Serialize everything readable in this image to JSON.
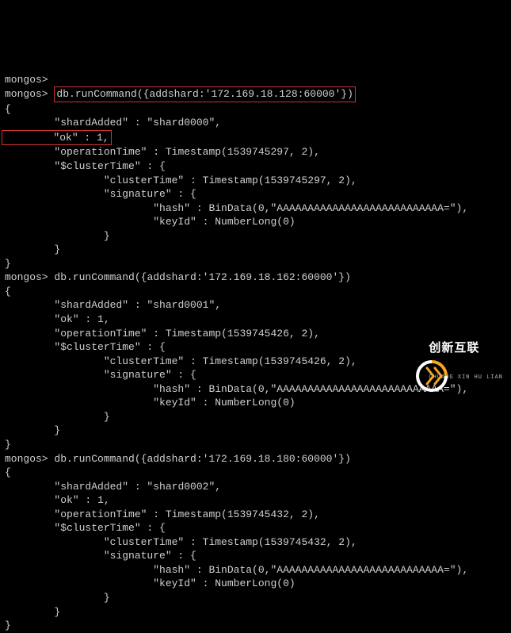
{
  "prompt": "mongos>",
  "commands": [
    "db.runCommand({addshard:'172.169.18.128:60000'})",
    "db.runCommand({addshard:'172.169.18.162:60000'})",
    "db.runCommand({addshard:'172.169.18.180:60000'})"
  ],
  "responses": [
    {
      "shardAdded": "shard0000",
      "ok": 1,
      "operationTimeTs": "Timestamp(1539745297, 2)",
      "clusterTimeTs": "Timestamp(1539745297, 2)",
      "hash": "BinData(0,\"AAAAAAAAAAAAAAAAAAAAAAAAAAA=\")",
      "keyId": "NumberLong(0)"
    },
    {
      "shardAdded": "shard0001",
      "ok": 1,
      "operationTimeTs": "Timestamp(1539745426, 2)",
      "clusterTimeTs": "Timestamp(1539745426, 2)",
      "hash": "BinData(0,\"AAAAAAAAAAAAAAAAAAAAAAAAAAA=\")",
      "keyId": "NumberLong(0)"
    },
    {
      "shardAdded": "shard0002",
      "ok": 1,
      "operationTimeTs": "Timestamp(1539745432, 2)",
      "clusterTimeTs": "Timestamp(1539745432, 2)",
      "hash": "BinData(0,\"AAAAAAAAAAAAAAAAAAAAAAAAAAA=\")",
      "keyId": "NumberLong(0)"
    }
  ],
  "logo": {
    "name": "创新互联",
    "sub": "CHUANG XIN HU LIAN"
  }
}
